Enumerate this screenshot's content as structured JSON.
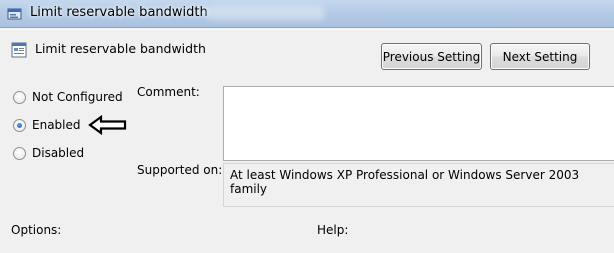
{
  "window": {
    "title": "Limit reservable bandwidth"
  },
  "header": {
    "policy_title": "Limit reservable bandwidth",
    "previous_button": "Previous Setting",
    "next_button": "Next Setting"
  },
  "state": {
    "options": [
      {
        "label": "Not Configured",
        "checked": false
      },
      {
        "label": "Enabled",
        "checked": true
      },
      {
        "label": "Disabled",
        "checked": false
      }
    ]
  },
  "comment": {
    "label": "Comment:",
    "value": ""
  },
  "supported": {
    "label": "Supported on:",
    "value": "At least Windows XP Professional or Windows Server 2003 family"
  },
  "footer": {
    "options_label": "Options:",
    "help_label": "Help:"
  },
  "colors": {
    "titlebar": "#b4cbe6",
    "dialog_background": "#f0f0f0",
    "radio_selected": "#1b5fa8"
  },
  "icons": {
    "window": "group-policy-icon",
    "policy": "policy-setting-icon",
    "annotation": "left-arrow-icon"
  }
}
